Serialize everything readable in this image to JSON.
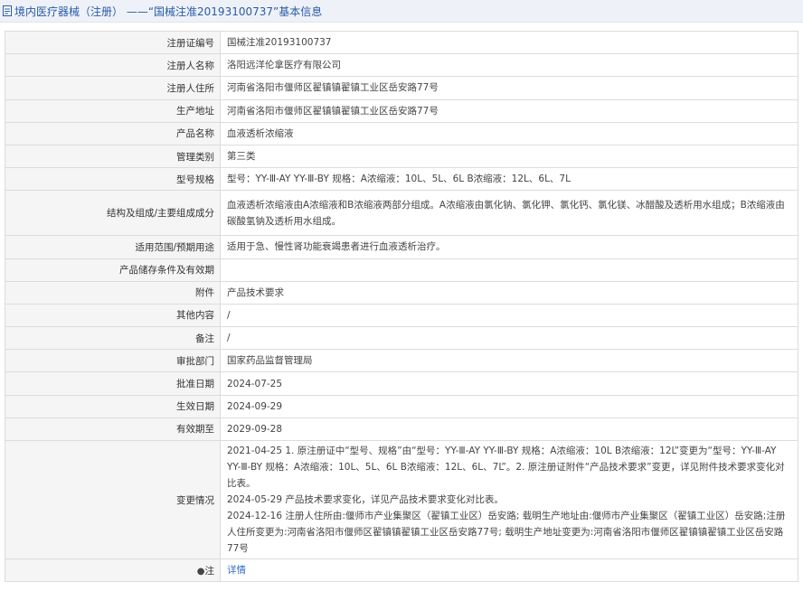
{
  "header": {
    "title": "境内医疗器械（注册） ——“国械注准20193100737”基本信息"
  },
  "rows": [
    {
      "label": "注册证编号",
      "value": "国械注准20193100737"
    },
    {
      "label": "注册人名称",
      "value": "洛阳远洋伦拿医疗有限公司"
    },
    {
      "label": "注册人住所",
      "value": "河南省洛阳市偃师区翟镇镇翟镇工业区岳安路77号"
    },
    {
      "label": "生产地址",
      "value": "河南省洛阳市偃师区翟镇镇翟镇工业区岳安路77号"
    },
    {
      "label": "产品名称",
      "value": "血液透析浓缩液"
    },
    {
      "label": "管理类别",
      "value": "第三类"
    },
    {
      "label": "型号规格",
      "value": "型号：YY-Ⅲ-AY YY-Ⅲ-BY 规格：A浓缩液：10L、5L、6L B浓缩液：12L、6L、7L"
    },
    {
      "label": "结构及组成/主要组成成分",
      "value": "血液透析浓缩液由A浓缩液和B浓缩液两部分组成。A浓缩液由氯化钠、氯化钾、氯化钙、氯化镁、冰醋酸及透析用水组成；B浓缩液由碳酸氢钠及透析用水组成。"
    },
    {
      "label": "适用范围/预期用途",
      "value": "适用于急、慢性肾功能衰竭患者进行血液透析治疗。"
    },
    {
      "label": "产品储存条件及有效期",
      "value": ""
    },
    {
      "label": "附件",
      "value": "产品技术要求"
    },
    {
      "label": "其他内容",
      "value": "/"
    },
    {
      "label": "备注",
      "value": "/"
    },
    {
      "label": "审批部门",
      "value": "国家药品监督管理局"
    },
    {
      "label": "批准日期",
      "value": "2024-07-25"
    },
    {
      "label": "生效日期",
      "value": "2024-09-29"
    },
    {
      "label": "有效期至",
      "value": "2029-09-28"
    }
  ],
  "changes": {
    "label": "变更情况",
    "lines": [
      "2021-04-25 1. 原注册证中“型号、规格”由“型号：YY-Ⅲ-AY YY-Ⅲ-BY 规格：A浓缩液：10L B浓缩液：12L”变更为“型号：YY-Ⅲ-AY YY-Ⅲ-BY 规格：A浓缩液：10L、5L、6L B浓缩液：12L、6L、7L”。2. 原注册证附件“产品技术要求”变更，详见附件技术要求变化对比表。",
      "2024-05-29 产品技术要求变化，详见产品技术要求变化对比表。",
      "2024-12-16 注册人住所由:偃师市产业集聚区（翟镇工业区）岳安路; 载明生产地址由:偃师市产业集聚区（翟镇工业区）岳安路;注册人住所变更为:河南省洛阳市偃师区翟镇镇翟镇工业区岳安路77号; 载明生产地址变更为:河南省洛阳市偃师区翟镇镇翟镇工业区岳安路77号"
    ]
  },
  "note_row": {
    "label": "注",
    "link": "详情"
  },
  "colors": {
    "header_text": "#2a5aa8",
    "link": "#2f6cc4",
    "label_bg": "#f5f5f5",
    "border": "#dcdcdc"
  }
}
